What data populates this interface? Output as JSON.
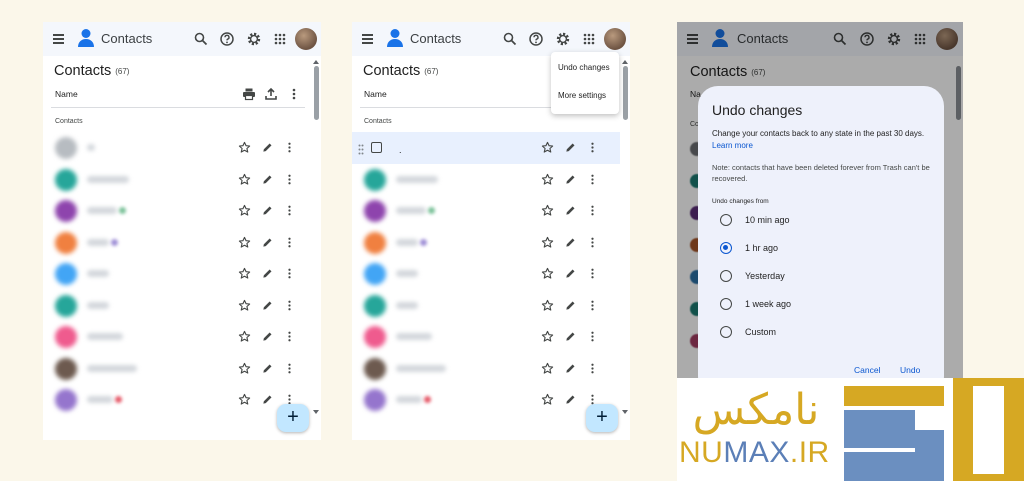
{
  "app": {
    "title": "Contacts",
    "count": "(67)",
    "column_name": "Name",
    "section_label": "Contacts",
    "fab_label": "+"
  },
  "panel_a": {
    "contacts": [
      {
        "color": "#b7bcc1",
        "name_width": 8
      },
      {
        "color": "#26a69a",
        "name_width": 42
      },
      {
        "color": "#8e44ad",
        "name_width": 30,
        "tag": "#7cc29a"
      },
      {
        "color": "#f08040",
        "name_width": 22,
        "tag": "#9f8fd6"
      },
      {
        "color": "#42a5f5",
        "name_width": 22
      },
      {
        "color": "#26a69a",
        "name_width": 22
      },
      {
        "color": "#ef5b8e",
        "name_width": 36
      },
      {
        "color": "#6d5a4f",
        "name_width": 50
      },
      {
        "color": "#9575cd",
        "name_width": 26,
        "tag": "#e55b6a"
      }
    ]
  },
  "panel_b": {
    "menu": {
      "undo_changes": "Undo changes",
      "more_settings": "More settings"
    },
    "selected_row_text": "."
  },
  "dialog": {
    "title": "Undo changes",
    "description": "Change your contacts back to any state in the past 30 days.",
    "learn_more": "Learn more",
    "note": "Note: contacts that have been deleted forever from Trash can't be recovered.",
    "from_label": "Undo changes from",
    "options": [
      {
        "label": "10 min ago",
        "selected": false
      },
      {
        "label": "1 hr ago",
        "selected": true
      },
      {
        "label": "Yesterday",
        "selected": false
      },
      {
        "label": "1 week ago",
        "selected": false
      },
      {
        "label": "Custom",
        "selected": false
      }
    ],
    "cancel": "Cancel",
    "undo": "Undo"
  },
  "panel_c_bg": {
    "column_stub": "Na",
    "section_stub": "Co",
    "avatar_colors": [
      "#6b6e72",
      "#1c7a71",
      "#5a2d78",
      "#a55429",
      "#2b6fa5",
      "#1c7a71",
      "#a23d62"
    ]
  },
  "watermark": {
    "persian": "نامکس",
    "latin_primary": "NU",
    "latin_accent": "MAX",
    "latin_suffix": ".IR",
    "colors": {
      "gold": "#d6a823",
      "blue": "#6b8fc0"
    }
  },
  "icons": {
    "menu": "hamburger-icon",
    "search": "search-icon",
    "help": "help-icon",
    "settings": "gear-icon",
    "apps": "apps-grid-icon",
    "print": "print-icon",
    "export": "export-icon",
    "more": "more-vert-icon",
    "star": "star-icon",
    "edit": "pencil-icon"
  }
}
